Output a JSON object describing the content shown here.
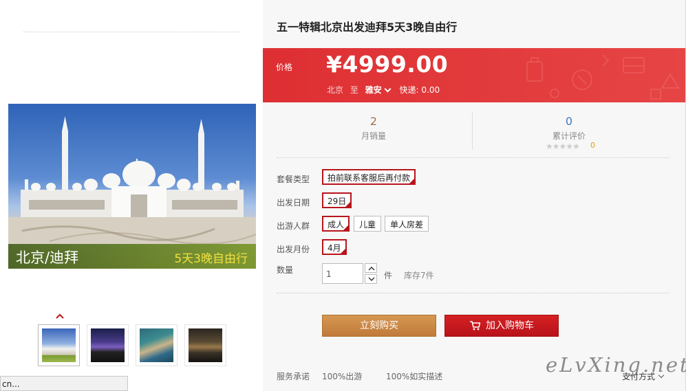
{
  "product": {
    "title": "五一特辑北京出发迪拜5天3晚自由行",
    "image_caption_left": "北京/迪拜",
    "image_caption_right": "5天3晚自由行"
  },
  "price": {
    "label": "价格",
    "value": "¥4999.00",
    "origin": "北京",
    "to": "至",
    "destination": "雅安",
    "shipping": "快递: 0.00"
  },
  "stats": {
    "sales_count": "2",
    "sales_label": "月销量",
    "reviews_count": "0",
    "reviews_label": "累计评价",
    "stars": "★★★★★",
    "rating_value": "0"
  },
  "options": {
    "package": {
      "label": "套餐类型",
      "choices": [
        "拍前联系客服后再付款"
      ],
      "selected": 0
    },
    "date": {
      "label": "出发日期",
      "choices": [
        "29日"
      ],
      "selected": 0
    },
    "traveler": {
      "label": "出游人群",
      "choices": [
        "成人",
        "儿童",
        "单人房差"
      ],
      "selected": 0
    },
    "month": {
      "label": "出发月份",
      "choices": [
        "4月"
      ],
      "selected": 0
    }
  },
  "quantity": {
    "label": "数量",
    "value": "1",
    "unit": "件",
    "stock": "库存7件"
  },
  "actions": {
    "buy_now": "立刻购买",
    "add_to_cart": "加入购物车"
  },
  "service": {
    "label": "服务承诺",
    "items": [
      "100%出游",
      "100%如实描述"
    ],
    "payment": "支付方式"
  },
  "status_bar": {
    "text": "cn..."
  },
  "watermark": "eLvXing.net",
  "colors": {
    "price_bar": "#e03a3c",
    "buy_button": "#c98842",
    "cart_button": "#c4161c",
    "selected_border": "#b8141c"
  },
  "icons": [
    "chevron-up-icon",
    "chevron-down-icon",
    "cart-icon"
  ]
}
